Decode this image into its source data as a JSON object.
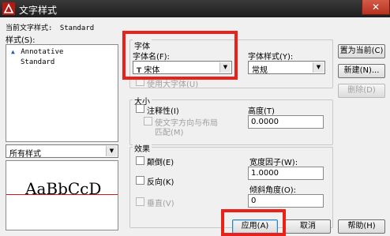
{
  "window": {
    "title": "文字样式",
    "close_glyph": "✕"
  },
  "current_style": {
    "label": "当前文字样式:",
    "value": "Standard"
  },
  "styles_section": {
    "label": "样式(S):",
    "items": [
      {
        "icon": "annotative-triangle-icon",
        "label": "Annotative"
      },
      {
        "label": "Standard"
      }
    ]
  },
  "filter": {
    "value": "所有样式"
  },
  "preview": {
    "text": "AaBbCcD",
    "line_color": "#d21a1a"
  },
  "font_group": {
    "title": "字体",
    "font_name_label": "字体名(F):",
    "font_name_value": "宋体",
    "font_style_label": "字体样式(Y):",
    "font_style_value": "常规",
    "big_font_label": "使用大字体(U)"
  },
  "size_group": {
    "title": "大小",
    "annotative_label": "注释性(I)",
    "match_orientation_line1": "使文字方向与布局",
    "match_orientation_line2": "匹配(M)",
    "height_label": "高度(T)",
    "height_value": "0.0000"
  },
  "effects_group": {
    "title": "效果",
    "upside_down_label": "颠倒(E)",
    "backwards_label": "反向(K)",
    "vertical_label": "垂直(V)",
    "width_factor_label": "宽度因子(W):",
    "width_factor_value": "1.0000",
    "oblique_label": "倾斜角度(O):",
    "oblique_value": "0"
  },
  "buttons": {
    "set_current": "置为当前(C)",
    "new": "新建(N)...",
    "delete": "删除(D)",
    "apply": "应用(A)",
    "cancel": "取消",
    "help": "帮助(H)"
  },
  "colors": {
    "highlight": "#e8221a"
  }
}
